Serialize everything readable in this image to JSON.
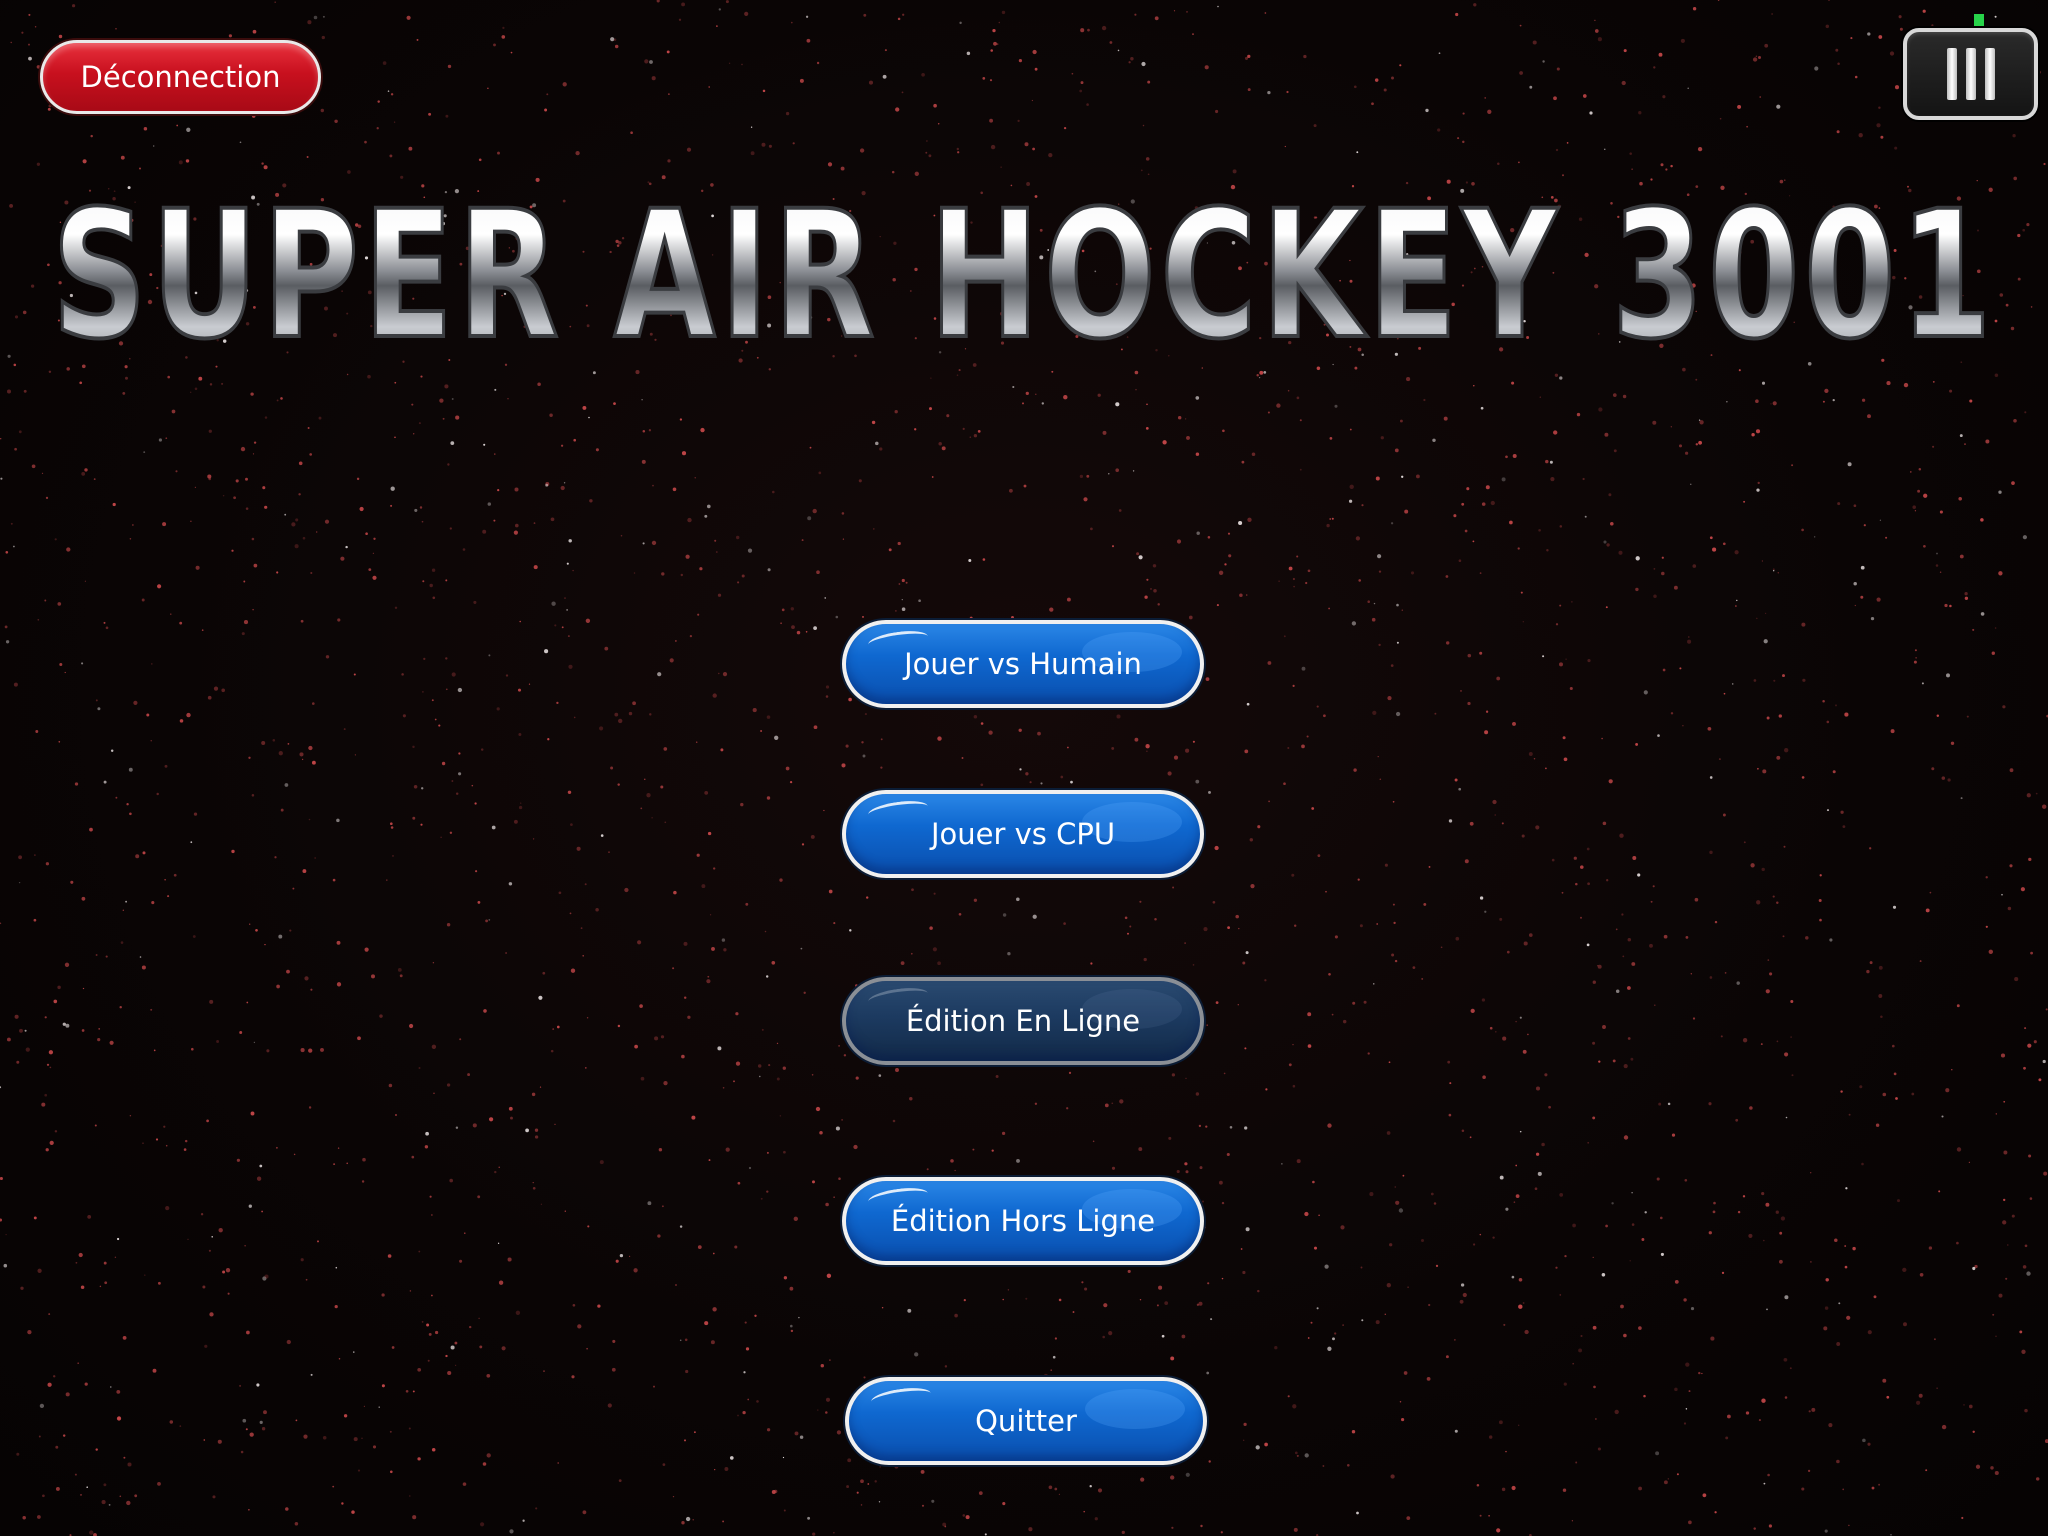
{
  "header": {
    "logout_label": "Déconnection",
    "menu_icon": "hamburger-vertical-bars-icon"
  },
  "title": {
    "text": "SUPER AIR HOCKEY 3001"
  },
  "menu": {
    "items": [
      {
        "label": "Jouer vs Humain",
        "enabled": true
      },
      {
        "label": "Jouer vs CPU",
        "enabled": true
      },
      {
        "label": "Édition En Ligne",
        "enabled": false
      },
      {
        "label": "Édition Hors Ligne",
        "enabled": true
      },
      {
        "label": "Quitter",
        "enabled": true
      }
    ]
  },
  "colors": {
    "background": "#0a0606",
    "star": "#c8484a",
    "logout_button": "#c8101e",
    "menu_button": "#0f68d0",
    "menu_button_disabled": "#1c3a60",
    "status_indicator": "#27d34a"
  }
}
